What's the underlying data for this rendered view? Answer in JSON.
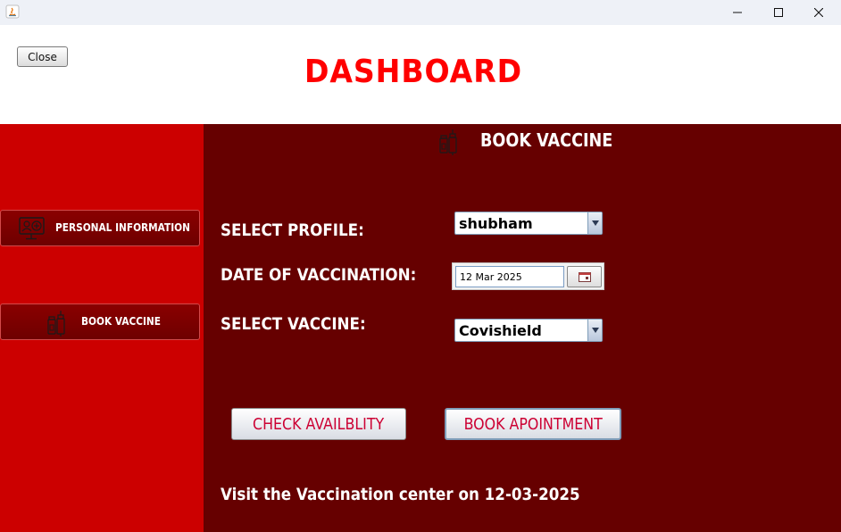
{
  "window": {
    "controls": {
      "minimize": "—",
      "maximize": "☐",
      "close": "✕"
    }
  },
  "header": {
    "close_label": "Close",
    "title": "DASHBOARD"
  },
  "sidebar": {
    "items": [
      {
        "label": "PERSONAL INFORMATION",
        "icon": "monitor-user-icon"
      },
      {
        "label": "BOOK VACCINE",
        "icon": "vaccine-vial-icon"
      }
    ]
  },
  "main": {
    "title": "BOOK VACCINE",
    "title_icon": "vaccine-vial-icon",
    "fields": {
      "profile_label": "SELECT PROFILE:",
      "profile_value": "shubham",
      "date_label": "DATE OF VACCINATION:",
      "date_value": "12 Mar 2025",
      "vaccine_label": "SELECT VACCINE:",
      "vaccine_value": "Covishield"
    },
    "buttons": {
      "check": "CHECK AVAILBLITY",
      "book": "BOOK APOINTMENT"
    },
    "status": "Visit the Vaccination center on 12-03-2025"
  },
  "colors": {
    "title_red": "#ff0000",
    "sidebar_red": "#cc0000",
    "main_maroon": "#660000",
    "button_text": "#cc0033"
  }
}
